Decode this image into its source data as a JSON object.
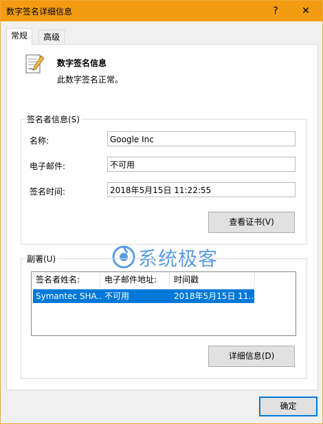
{
  "window": {
    "title": "数字签名详细信息",
    "help_glyph": "?",
    "close_glyph": "✕"
  },
  "tabs": [
    {
      "label": "常规"
    },
    {
      "label": "高级"
    }
  ],
  "signature_info": {
    "title": "数字签名信息",
    "status": "此数字签名正常。"
  },
  "signer": {
    "group_label": "签名者信息(S)",
    "name_label": "名称:",
    "name_value": "Google Inc",
    "email_label": "电子邮件:",
    "email_value": "不可用",
    "time_label": "签名时间:",
    "time_value": "2018年5月15日 11:22:55",
    "view_cert_button": "查看证书(V)"
  },
  "countersignatures": {
    "group_label": "副署(U)",
    "columns": [
      "签名者姓名:",
      "电子邮件地址:",
      "时间戳"
    ],
    "rows": [
      {
        "name": "Symantec SHA...",
        "email": "不可用",
        "timestamp": "2018年5月15日 11..."
      }
    ],
    "details_button": "详细信息(D)"
  },
  "footer": {
    "ok_button": "确定"
  },
  "watermark": {
    "text": "系统极客"
  },
  "colors": {
    "titlebar": "#f39c12",
    "selection": "#0078d7",
    "accent_border": "#0078d7"
  }
}
